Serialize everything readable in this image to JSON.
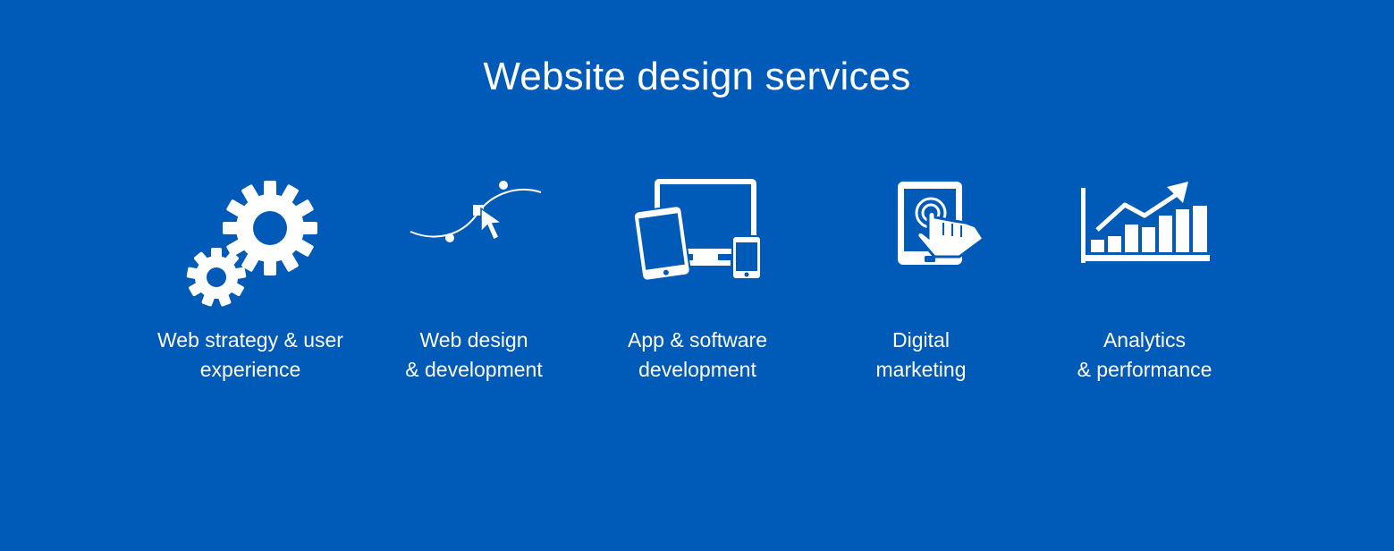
{
  "page": {
    "background_color": "#005ab7",
    "text_color": "#ffffff"
  },
  "heading": "Website design services",
  "services": [
    {
      "icon": "gears-icon",
      "label_line1": "Web strategy & user",
      "label_line2": "experience"
    },
    {
      "icon": "cursor-curve-icon",
      "label_line1": "Web design",
      "label_line2": "& development"
    },
    {
      "icon": "devices-icon",
      "label_line1": "App & software",
      "label_line2": "development"
    },
    {
      "icon": "tablet-touch-icon",
      "label_line1": "Digital",
      "label_line2": "marketing"
    },
    {
      "icon": "bar-chart-trend-icon",
      "label_line1": "Analytics",
      "label_line2": "& performance"
    }
  ]
}
